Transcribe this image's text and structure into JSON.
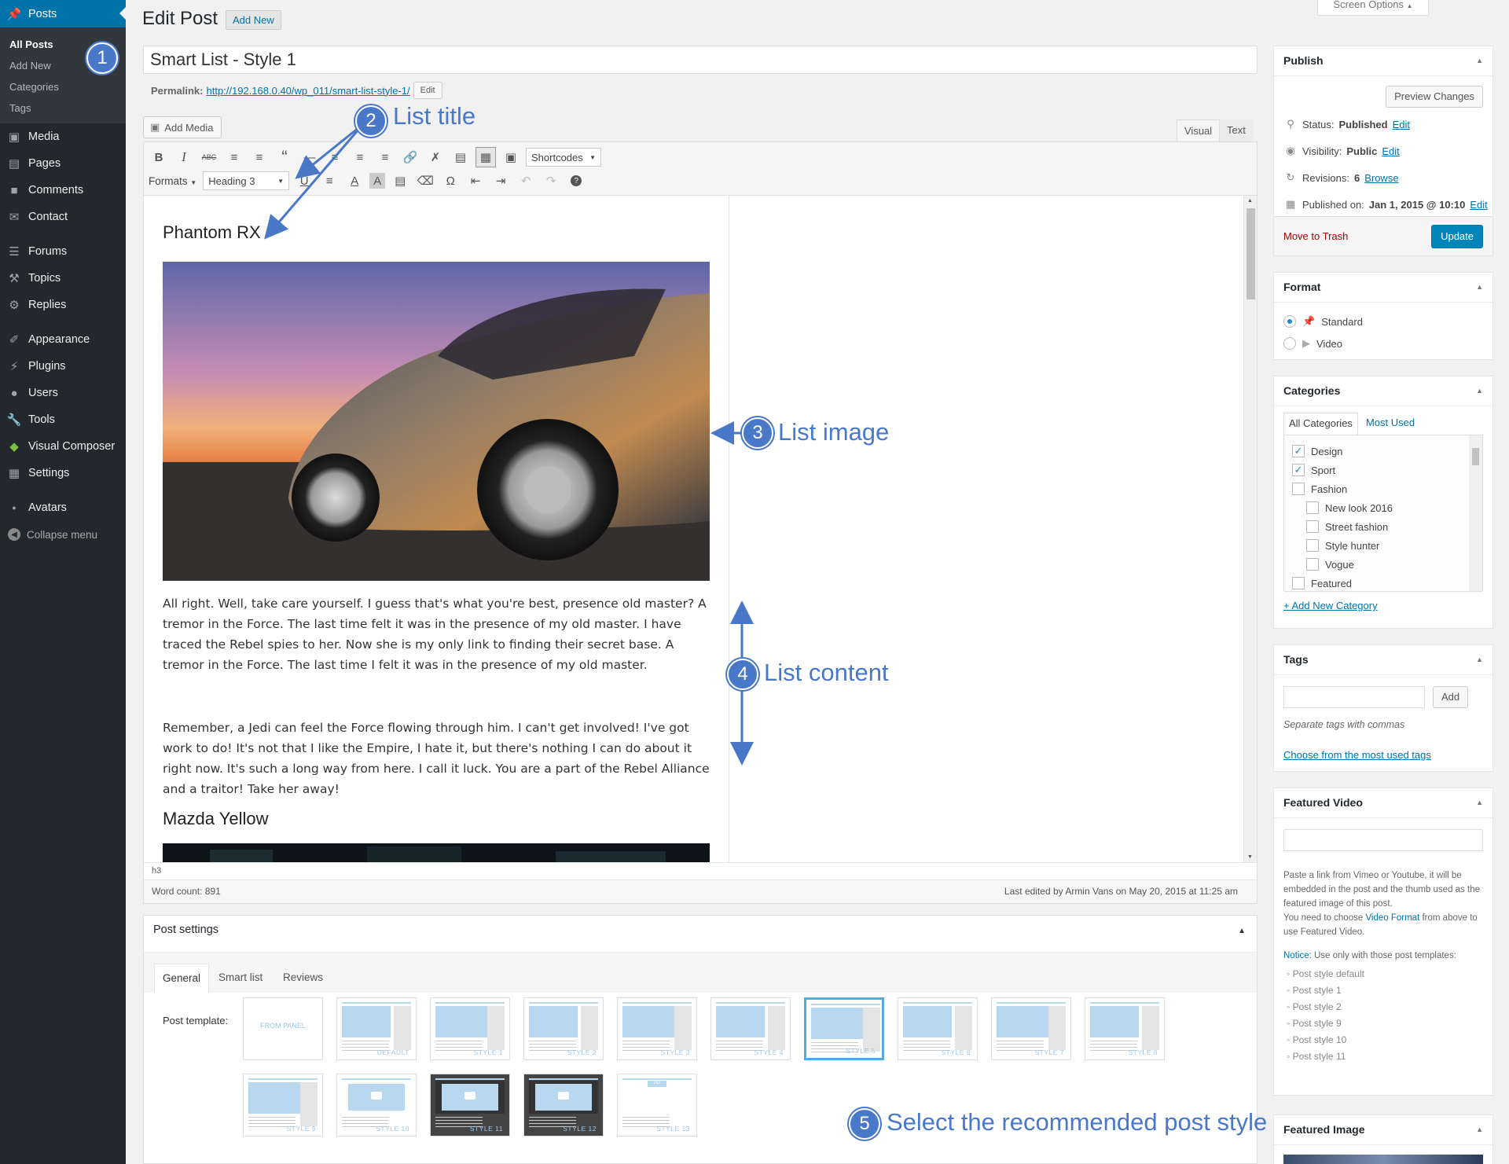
{
  "sidebar": {
    "posts": "Posts",
    "posts_submenu": [
      "All Posts",
      "Add New",
      "Categories",
      "Tags"
    ],
    "group1": [
      "Media",
      "Pages",
      "Comments",
      "Contact"
    ],
    "group2": [
      "Forums",
      "Topics",
      "Replies"
    ],
    "group3": [
      "Appearance",
      "Plugins",
      "Users",
      "Tools",
      "Visual Composer",
      "Settings"
    ],
    "avatars": "Avatars",
    "collapse": "Collapse menu"
  },
  "header": {
    "title": "Edit Post",
    "add_new": "Add New",
    "screen_options": "Screen Options"
  },
  "post": {
    "title": "Smart List - Style 1",
    "permalink_label": "Permalink:",
    "permalink_url": "http://192.168.0.40/wp_011/smart-list-style-1/",
    "permalink_edit": "Edit"
  },
  "editor": {
    "add_media": "Add Media",
    "tab_visual": "Visual",
    "tab_text": "Text",
    "shortcodes": "Shortcodes",
    "formats": "Formats",
    "heading": "Heading 3",
    "heading1": "Phantom RX",
    "paragraph1": "All right. Well, take care yourself. I guess that's what you're best, presence old master? A tremor in the Force. The last time felt it was in the presence of my old master. I have traced the Rebel spies to her. Now she is my only link to finding their secret base. A tremor in the Force. The last time I felt it was in the presence of my old master.",
    "paragraph2": "Remember, a Jedi can feel the Force flowing through him. I can't get involved! I've got work to do! It's not that I like the Empire, I hate it, but there's nothing I can do about it right now. It's such a long way from here. I call it luck. You are a part of the Rebel Alliance and a traitor! Take her away!",
    "heading2": "Mazda Yellow",
    "path": "h3",
    "word_count": "Word count: 891",
    "last_edited": "Last edited by Armin Vans on May 20, 2015 at 11:25 am"
  },
  "annotations": {
    "n1": "1",
    "n2": "2",
    "n3": "3",
    "n4": "4",
    "n5": "5",
    "list_title": "List title",
    "list_image": "List image",
    "list_content": "List content",
    "select_style": "Select the recommended post style",
    "color": "#4a78c8"
  },
  "post_settings": {
    "title": "Post settings",
    "tabs": [
      "General",
      "Smart list",
      "Reviews"
    ],
    "template_label": "Post template:",
    "help": "?",
    "templates": [
      "FROM PANEL",
      "DEFAULT",
      "STYLE 1",
      "STYLE 2",
      "STYLE 3",
      "STYLE 4",
      "STYLE 5",
      "STYLE 6",
      "STYLE 7",
      "STYLE 8",
      "STYLE 9",
      "STYLE 10",
      "STYLE 11",
      "STYLE 12",
      "STYLE 13"
    ],
    "selected": "STYLE 5"
  },
  "publish": {
    "title": "Publish",
    "preview": "Preview Changes",
    "status_label": "Status:",
    "status_value": "Published",
    "visibility_label": "Visibility:",
    "visibility_value": "Public",
    "revisions_label": "Revisions:",
    "revisions_value": "6",
    "browse": "Browse",
    "published_label": "Published on:",
    "published_value": "Jan 1, 2015 @ 10:10",
    "edit": "Edit",
    "trash": "Move to Trash",
    "update": "Update"
  },
  "format": {
    "title": "Format",
    "options": [
      "Standard",
      "Video"
    ],
    "selected": "Standard"
  },
  "categories": {
    "title": "Categories",
    "tab_all": "All Categories",
    "tab_most": "Most Used",
    "items": [
      {
        "name": "Design",
        "checked": true,
        "child": false
      },
      {
        "name": "Sport",
        "checked": true,
        "child": false
      },
      {
        "name": "Fashion",
        "checked": false,
        "child": false
      },
      {
        "name": "New look 2016",
        "checked": false,
        "child": true
      },
      {
        "name": "Street fashion",
        "checked": false,
        "child": true
      },
      {
        "name": "Style hunter",
        "checked": false,
        "child": true
      },
      {
        "name": "Vogue",
        "checked": false,
        "child": true
      },
      {
        "name": "Featured",
        "checked": false,
        "child": false
      }
    ],
    "add_new": "+ Add New Category"
  },
  "tags": {
    "title": "Tags",
    "add": "Add",
    "hint": "Separate tags with commas",
    "choose": "Choose from the most used tags"
  },
  "featured_video": {
    "title": "Featured Video",
    "desc1": "Paste a link from Vimeo or Youtube, it will be embedded in the post and the thumb used as the featured image of this post.",
    "desc2_pre": "You need to choose ",
    "desc2_link": "Video Format",
    "desc2_post": " from above to use Featured Video.",
    "notice_label": "Notice:",
    "notice_text": " Use only with those post templates:",
    "templates": [
      "Post style default",
      "Post style 1",
      "Post style 2",
      "Post style 9",
      "Post style 10",
      "Post style 11"
    ]
  },
  "featured_image": {
    "title": "Featured Image"
  }
}
